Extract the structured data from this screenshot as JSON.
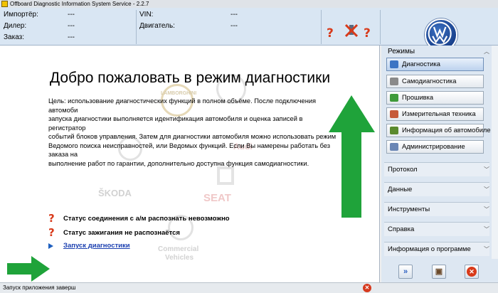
{
  "window": {
    "title": "Offboard Diagnostic Information System Service - 2.2.7"
  },
  "info": {
    "importer_label": "Импортёр:",
    "importer_value": "---",
    "dealer_label": "Дилер:",
    "dealer_value": "---",
    "order_label": "Заказ:",
    "order_value": "---",
    "vin_label": "VIN:",
    "vin_value": "---",
    "engine_label": "Двигатель:",
    "engine_value": "---"
  },
  "content": {
    "title": "Добро пожаловать в режим диагностики",
    "text": "Цель: использование диагностических функций в полном объёме. После подключения автомоби\nзапуска диагностики выполняется идентификация автомобиля и оценка записей в регистратор\nсобытий блоков управления. Затем для диагностики автомобиля можно использовать режим\nВедомого поиска неисправностей, или Ведомых функций. Если Вы намерены работать без заказа на\nвыполнение работ по гарантии, дополнительно доступна функция самодиагностики.",
    "status_connection": "Статус соединения с а/м распознать невозможно",
    "status_ignition": "Статус зажигания не распознаётся",
    "launch_link": "Запуск диагностики",
    "watermarks": {
      "lamborghini": "LAMBORGHINI",
      "audi": "Audi",
      "skoda": "ŠKODA",
      "seat": "SEAT",
      "commercial": "Commercial",
      "vehicles": "Vehicles"
    }
  },
  "panel": {
    "header": "Режимы",
    "modes": [
      {
        "label": "Диагностика",
        "icon": "stethoscope-icon",
        "color": "#3c74c4"
      },
      {
        "label": "Самодиагностика",
        "icon": "self-diagnosis-icon",
        "color": "#8a8a8a"
      },
      {
        "label": "Прошивка",
        "icon": "flash-icon",
        "color": "#3f9a3a"
      },
      {
        "label": "Измерительная техника",
        "icon": "measurement-icon",
        "color": "#c65a3a"
      },
      {
        "label": "Информация об автомобиле",
        "icon": "car-info-icon",
        "color": "#5a8a2e"
      },
      {
        "label": "Администрирование",
        "icon": "admin-icon",
        "color": "#6a86b5"
      }
    ],
    "sections": [
      "Протокол",
      "Данные",
      "Инструменты",
      "Справка",
      "Информация о программе"
    ]
  },
  "statusbar": {
    "text": "Запуск приложения заверш"
  },
  "colors": {
    "accent": "#0c2f78",
    "arrow": "#1fa33a",
    "error": "#d83a1a"
  }
}
